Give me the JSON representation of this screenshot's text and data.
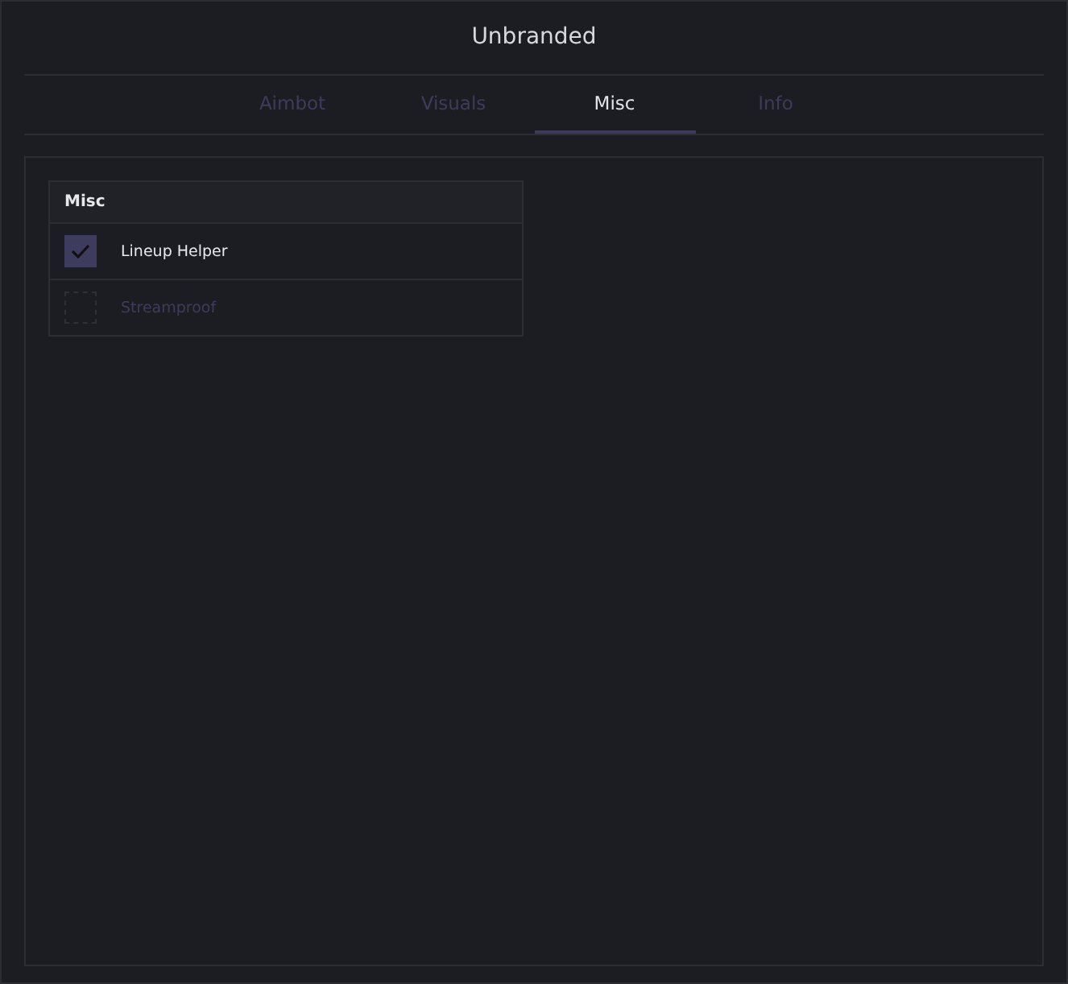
{
  "window": {
    "title": "Unbranded"
  },
  "tabs": [
    {
      "label": "Aimbot",
      "selected": false
    },
    {
      "label": "Visuals",
      "selected": false
    },
    {
      "label": "Misc",
      "selected": true
    },
    {
      "label": "Info",
      "selected": false
    }
  ],
  "group": {
    "title": "Misc",
    "options": [
      {
        "label": "Lineup Helper",
        "checked": true
      },
      {
        "label": "Streamproof",
        "checked": false
      }
    ]
  }
}
